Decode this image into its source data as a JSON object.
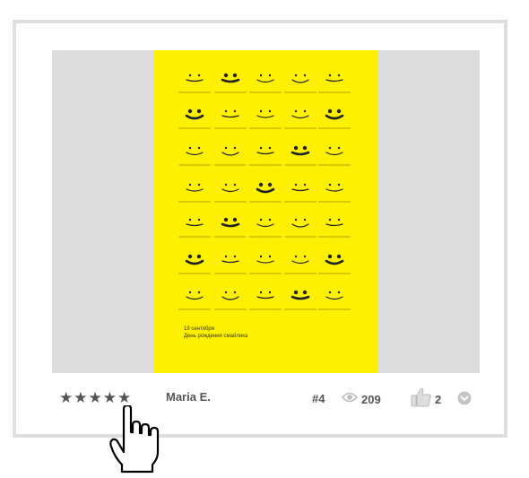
{
  "poster": {
    "caption_line1": "19 сентября",
    "caption_line2": "День рождения смайлика"
  },
  "footer": {
    "rating": 5,
    "stars": [
      "★",
      "★",
      "★",
      "★",
      "★"
    ],
    "author": "Maria E.",
    "rank": "#4",
    "views": "209",
    "likes": "2"
  },
  "icons": {
    "views": "eye-icon",
    "likes": "thumbs-up-icon",
    "more": "chevron-down-circle-icon",
    "cursor": "hand-pointer-cursor"
  },
  "colors": {
    "poster": "#fef000",
    "frame": "#dcdcdc",
    "border": "#dedede",
    "text": "#555555",
    "icon": "#bbbbbb"
  }
}
